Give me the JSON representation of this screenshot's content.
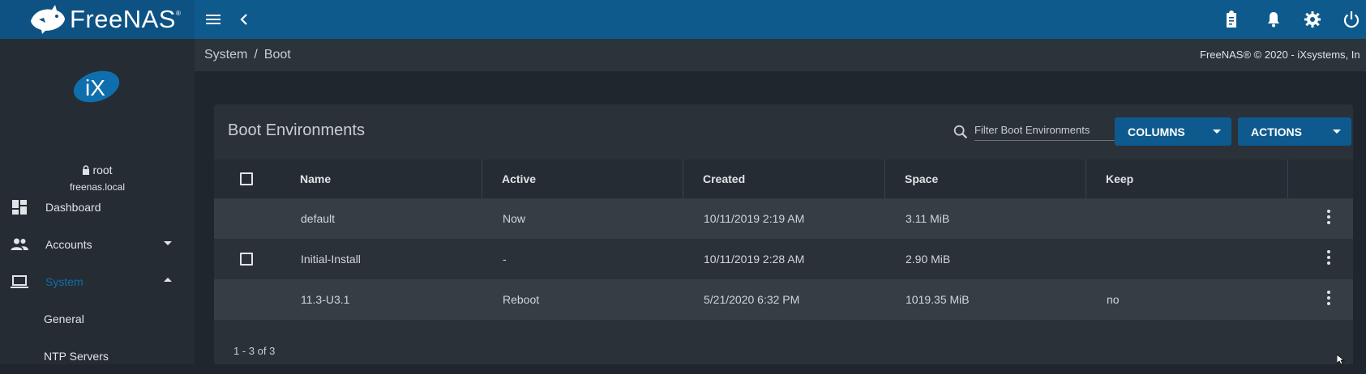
{
  "app": {
    "name": "FreeNAS",
    "trademark": "®"
  },
  "topbar": {
    "icons": [
      "menu-icon",
      "back-chevron-icon",
      "clipboard-icon",
      "bell-icon",
      "gear-icon",
      "power-icon"
    ]
  },
  "sidebar": {
    "user": "root",
    "host": "freenas.local",
    "items": [
      {
        "label": "Dashboard",
        "icon": "dashboard-icon"
      },
      {
        "label": "Accounts",
        "icon": "accounts-icon"
      },
      {
        "label": "System",
        "icon": "laptop-icon"
      }
    ],
    "sub_items": [
      {
        "label": "General"
      },
      {
        "label": "NTP Servers"
      }
    ]
  },
  "breadcrumb": {
    "parent": "System",
    "separator": "/",
    "current": "Boot"
  },
  "copyright": "FreeNAS® © 2020 - iXsystems, In",
  "card": {
    "title": "Boot Environments",
    "filter_placeholder": "Filter Boot Environments",
    "columns_button": "COLUMNS",
    "actions_button": "ACTIONS"
  },
  "table": {
    "headers": {
      "name": "Name",
      "active": "Active",
      "created": "Created",
      "space": "Space",
      "keep": "Keep"
    },
    "rows": [
      {
        "name": "default",
        "active": "Now",
        "created": "10/11/2019 2:19 AM",
        "space": "3.11 MiB",
        "keep": ""
      },
      {
        "name": "Initial-Install",
        "active": "-",
        "created": "10/11/2019 2:28 AM",
        "space": "2.90 MiB",
        "keep": ""
      },
      {
        "name": "11.3-U3.1",
        "active": "Reboot",
        "created": "5/21/2020 6:32 PM",
        "space": "1019.35 MiB",
        "keep": "no"
      }
    ],
    "footer": "1 - 3 of 3"
  },
  "colors": {
    "topbar": "#0f5a8c",
    "accent": "#0e5a8e",
    "active_nav": "#0f6fad"
  }
}
